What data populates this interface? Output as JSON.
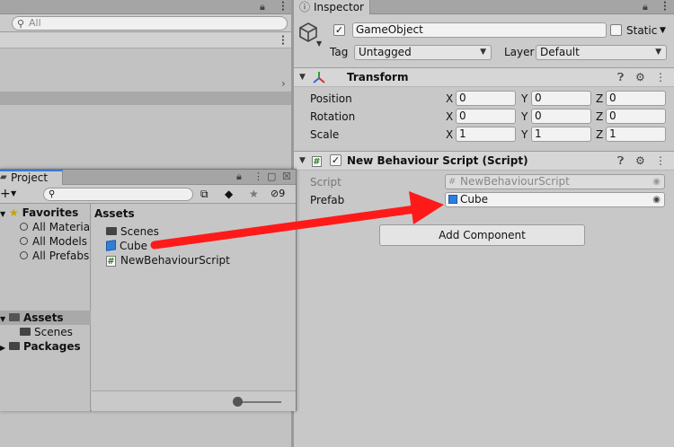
{
  "hierarchy": {
    "search_placeholder": "All"
  },
  "inspector": {
    "tab_label": "Inspector",
    "gameobject": {
      "active": true,
      "name": "GameObject",
      "static_label": "Static",
      "static_checked": false,
      "tag_label": "Tag",
      "tag_value": "Untagged",
      "layer_label": "Layer",
      "layer_value": "Default"
    },
    "transform": {
      "title": "Transform",
      "rows": [
        {
          "label": "Position",
          "x": "0",
          "y": "0",
          "z": "0"
        },
        {
          "label": "Rotation",
          "x": "0",
          "y": "0",
          "z": "0"
        },
        {
          "label": "Scale",
          "x": "1",
          "y": "1",
          "z": "1"
        }
      ],
      "axis_x": "X",
      "axis_y": "Y",
      "axis_z": "Z"
    },
    "script_component": {
      "title": "New Behaviour Script (Script)",
      "enabled": true,
      "script_label": "Script",
      "script_value": "NewBehaviourScript",
      "prefab_label": "Prefab",
      "prefab_value": "Cube"
    },
    "add_component_label": "Add Component"
  },
  "project": {
    "tab_label": "Project",
    "hidden_count": "9",
    "favorites": {
      "label": "Favorites",
      "items": [
        "All Materia",
        "All Models",
        "All Prefabs"
      ]
    },
    "tree": {
      "assets_label": "Assets",
      "assets_children": [
        "Scenes"
      ],
      "packages_label": "Packages"
    },
    "assets_header": "Assets",
    "assets_items": [
      {
        "name": "Scenes",
        "icon": "folder-icon"
      },
      {
        "name": "Cube",
        "icon": "prefab-cube-icon"
      },
      {
        "name": "NewBehaviourScript",
        "icon": "csharp-script-icon"
      }
    ]
  },
  "colors": {
    "drag_arrow": "#ff1a1a",
    "cube_blue": "#2f7fd8",
    "active_tab_accent": "#3a7ad6"
  }
}
